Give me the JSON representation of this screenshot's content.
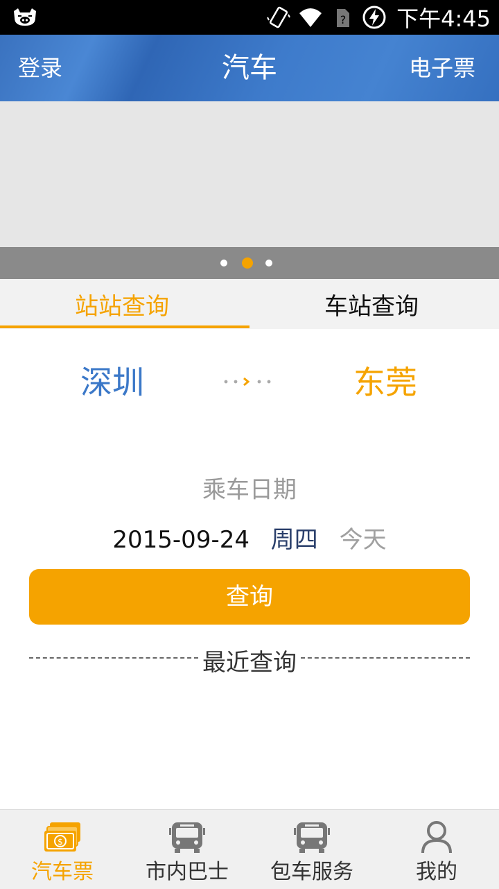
{
  "status_bar": {
    "time": "下午4:45"
  },
  "header": {
    "login": "登录",
    "title": "汽车",
    "eticket": "电子票"
  },
  "banner": {
    "pages": 3,
    "active_page": 2
  },
  "tabs": [
    {
      "label": "站站查询",
      "active": true
    },
    {
      "label": "车站查询",
      "active": false
    }
  ],
  "route": {
    "from": "深圳",
    "to": "东莞"
  },
  "date": {
    "label": "乘车日期",
    "value": "2015-09-24",
    "weekday": "周四",
    "relative": "今天"
  },
  "query_button": "查询",
  "recent_label": "最近查询",
  "bottom_nav": [
    {
      "label": "汽车票",
      "icon": "ticket-icon",
      "active": true
    },
    {
      "label": "市内巴士",
      "icon": "bus-icon",
      "active": false
    },
    {
      "label": "包车服务",
      "icon": "bus-icon",
      "active": false
    },
    {
      "label": "我的",
      "icon": "person-icon",
      "active": false
    }
  ],
  "colors": {
    "accent": "#f5a300",
    "header_blue": "#3e7bcb",
    "city_blue": "#3b78c8"
  }
}
